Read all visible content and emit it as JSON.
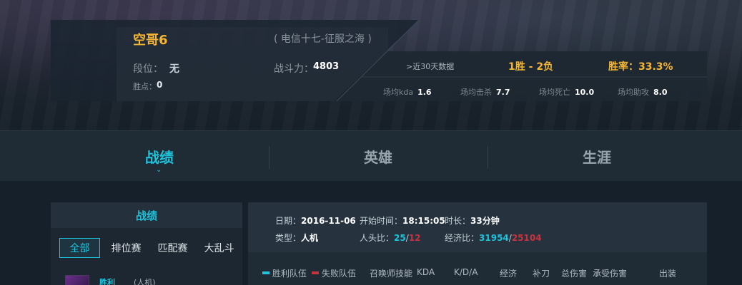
{
  "profile": {
    "name": "空哥6",
    "server": "( 电信十七-征服之海 )",
    "rank_label": "段位：",
    "rank_value": "无",
    "points_label": "胜点：",
    "points_value": "0",
    "power_label": "战斗力：",
    "power_value": "4803",
    "recent_label": ">近30天数据",
    "wins": "1胜",
    "separator": " - ",
    "losses": "2负",
    "winrate_label": "胜率：",
    "winrate_value": "33.3%",
    "averages": [
      {
        "label": "场均kda",
        "value": "1.6"
      },
      {
        "label": "场均击杀",
        "value": "7.7"
      },
      {
        "label": "场均死亡",
        "value": "10.0"
      },
      {
        "label": "场均助攻",
        "value": "8.0"
      }
    ]
  },
  "tabs": [
    {
      "label": "战绩",
      "active": true
    },
    {
      "label": "英雄",
      "active": false
    },
    {
      "label": "生涯",
      "active": false
    }
  ],
  "tab_chevron": "⌄",
  "left_panel": {
    "title": "战绩",
    "filters": [
      "全部",
      "排位赛",
      "匹配赛",
      "大乱斗"
    ],
    "match": {
      "result": "胜利",
      "type": "(人机)"
    }
  },
  "detail": {
    "date_label": "日期：",
    "date_value": "2016-11-06",
    "start_label": "开始时间：",
    "start_value": "18:15:05",
    "duration_label": "时长：",
    "duration_value": "33分钟",
    "type_label": "类型：",
    "type_value": "人机",
    "heads_label": "人头比：",
    "heads_ours": "25",
    "heads_sep": "/",
    "heads_theirs": "12",
    "econ_label": "经济比：",
    "econ_ours": "31954",
    "econ_sep": "/",
    "econ_theirs": "25104",
    "columns": [
      "胜利队伍",
      "失败队伍",
      "召唤师技能",
      "KDA",
      "K/D/A",
      "经济",
      "补刀",
      "总伤害",
      "承受伤害",
      "出装"
    ]
  },
  "colors": {
    "accent": "#1ec3dc",
    "gold": "#f5b532",
    "loss": "#c8323c"
  }
}
